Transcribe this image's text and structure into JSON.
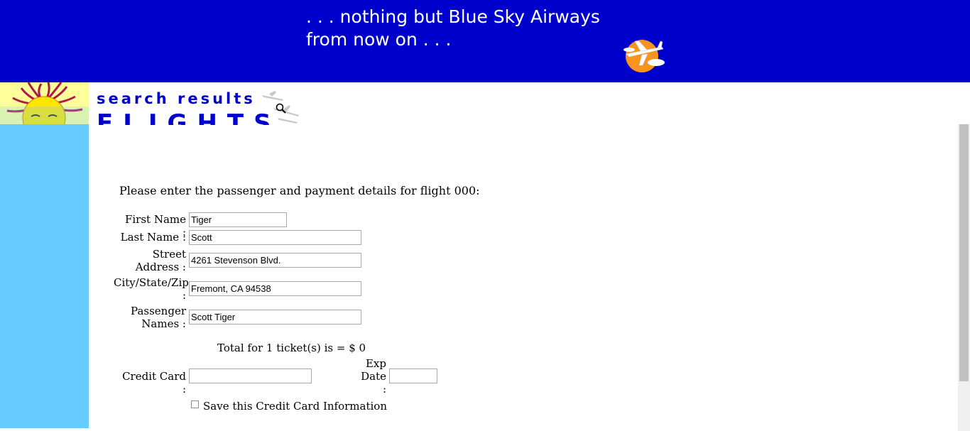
{
  "banner": {
    "tagline_line1": ". . . nothing but Blue Sky Airways",
    "tagline_line2": "from now on . . ."
  },
  "header": {
    "subtitle": "search results",
    "title": "FLIGHTS"
  },
  "form": {
    "intro": "Please enter the passenger and payment details for flight 000:",
    "first_name_label": "First Name :",
    "first_name_value": "Tiger",
    "last_name_label": "Last Name :",
    "last_name_value": "Scott",
    "street_label_1": "Street",
    "street_label_2": "Address :",
    "street_value": "4261 Stevenson Blvd.",
    "city_label_1": "City/State/Zip",
    "city_label_2": ":",
    "city_value": "Fremont, CA 94538",
    "passenger_label_1": "Passenger",
    "passenger_label_2": "Names :",
    "passenger_value": "Scott Tiger",
    "total_text": "Total for 1 ticket(s) is = $ 0",
    "credit_card_label": "Credit Card :",
    "credit_card_value": "",
    "exp_label_1": "Exp",
    "exp_label_2": "Date",
    "exp_label_3": ":",
    "exp_value": "",
    "save_card_label": "Save this Credit Card Information",
    "save_card_checked": false
  },
  "colors": {
    "banner_bg": "#0000cc",
    "sidebar_bg": "#66ccff",
    "title_color": "#0000cc"
  },
  "icons": [
    "plane-logo-icon",
    "sun-logo-icon",
    "magnifier-icon"
  ]
}
